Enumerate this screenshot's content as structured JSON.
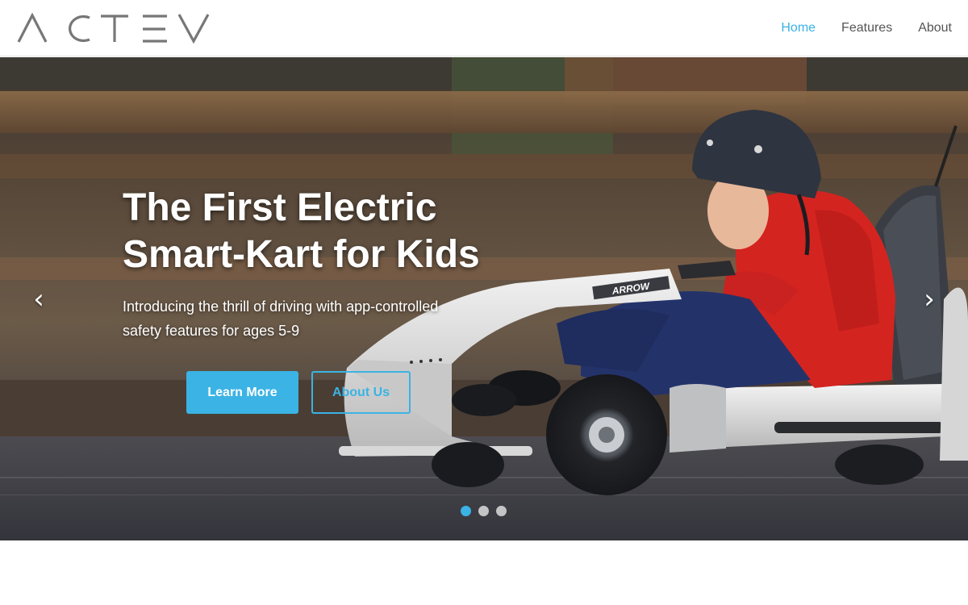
{
  "brand": {
    "logo_text": "ACTEV"
  },
  "nav": {
    "items": [
      {
        "label": "Home",
        "active": true
      },
      {
        "label": "Features",
        "active": false
      },
      {
        "label": "About",
        "active": false
      }
    ]
  },
  "hero": {
    "title_line1": "The First Electric",
    "title_line2": "Smart-Kart for Kids",
    "subtitle": "Introducing the thrill of driving with app-controlled safety features for ages 5-9",
    "primary_button": "Learn More",
    "secondary_button": "About Us",
    "kart_badge": "ARROW",
    "prev_arrow": "‹",
    "next_arrow": "›",
    "slides": {
      "count": 3,
      "active_index": 0
    }
  },
  "colors": {
    "accent": "#3bb3e4",
    "nav_text": "#555555",
    "logo_gray": "#777777",
    "jacket_red": "#d42420",
    "helmet": "#2e3440",
    "kart_silver": "#dcdcdc"
  }
}
